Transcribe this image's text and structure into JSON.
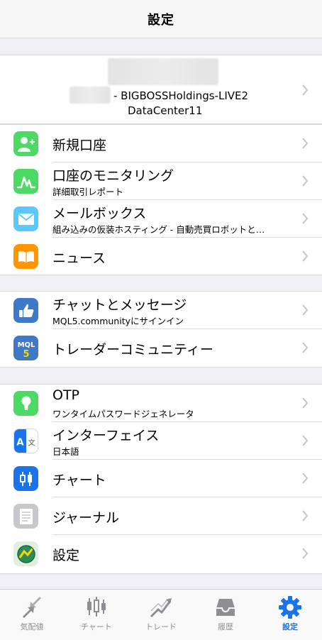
{
  "nav": {
    "title": "設定"
  },
  "account": {
    "line1": "- BIGBOSSHoldings-LIVE2",
    "line2": "DataCenter11"
  },
  "menu": {
    "new_account": {
      "label": "新規口座",
      "icon": "add-user-icon",
      "color": "#4cd964"
    },
    "monitoring": {
      "label": "口座のモニタリング",
      "sub": "詳細取引レポート",
      "icon": "chart-wave-icon",
      "color": "#4cd964"
    },
    "mailbox": {
      "label": "メールボックス",
      "sub": "組み込みの仮装ホスティング - 自動売買ロボットと…",
      "icon": "mail-icon",
      "color": "#5ac8fa"
    },
    "news": {
      "label": "ニュース",
      "icon": "book-icon",
      "color": "#ff9500"
    },
    "chat": {
      "label": "チャットとメッセージ",
      "sub": "MQL5.communityにサインイン",
      "icon": "thumbs-up-icon",
      "color": "#3d79c7"
    },
    "community": {
      "label": "トレーダーコミュニティー",
      "icon": "mql5-icon",
      "color": "#3d79c7"
    },
    "otp": {
      "label": "OTP",
      "sub": "ワンタイムパスワードジェネレータ",
      "icon": "keyhole-icon",
      "color": "#4cd964"
    },
    "interface": {
      "label": "インターフェイス",
      "sub": "日本語",
      "icon": "language-icon",
      "color": "#1a73e8"
    },
    "chart": {
      "label": "チャート",
      "icon": "candlestick-icon",
      "color": "#1a73e8"
    },
    "journal": {
      "label": "ジャーナル",
      "icon": "document-icon",
      "color": "#c7c7cc"
    },
    "settings": {
      "label": "設定",
      "icon": "metatrader-icon",
      "color": "#2e8b57"
    }
  },
  "tabs": [
    {
      "label": "気配値",
      "icon": "arrows-icon"
    },
    {
      "label": "チャート",
      "icon": "candlestick-icon"
    },
    {
      "label": "トレード",
      "icon": "trend-icon"
    },
    {
      "label": "履歴",
      "icon": "inbox-icon"
    },
    {
      "label": "設定",
      "icon": "gear-icon",
      "active": true
    }
  ],
  "colors": {
    "accent": "#1a73e8",
    "inactive": "#8e8e93",
    "background": "#efeff4"
  }
}
